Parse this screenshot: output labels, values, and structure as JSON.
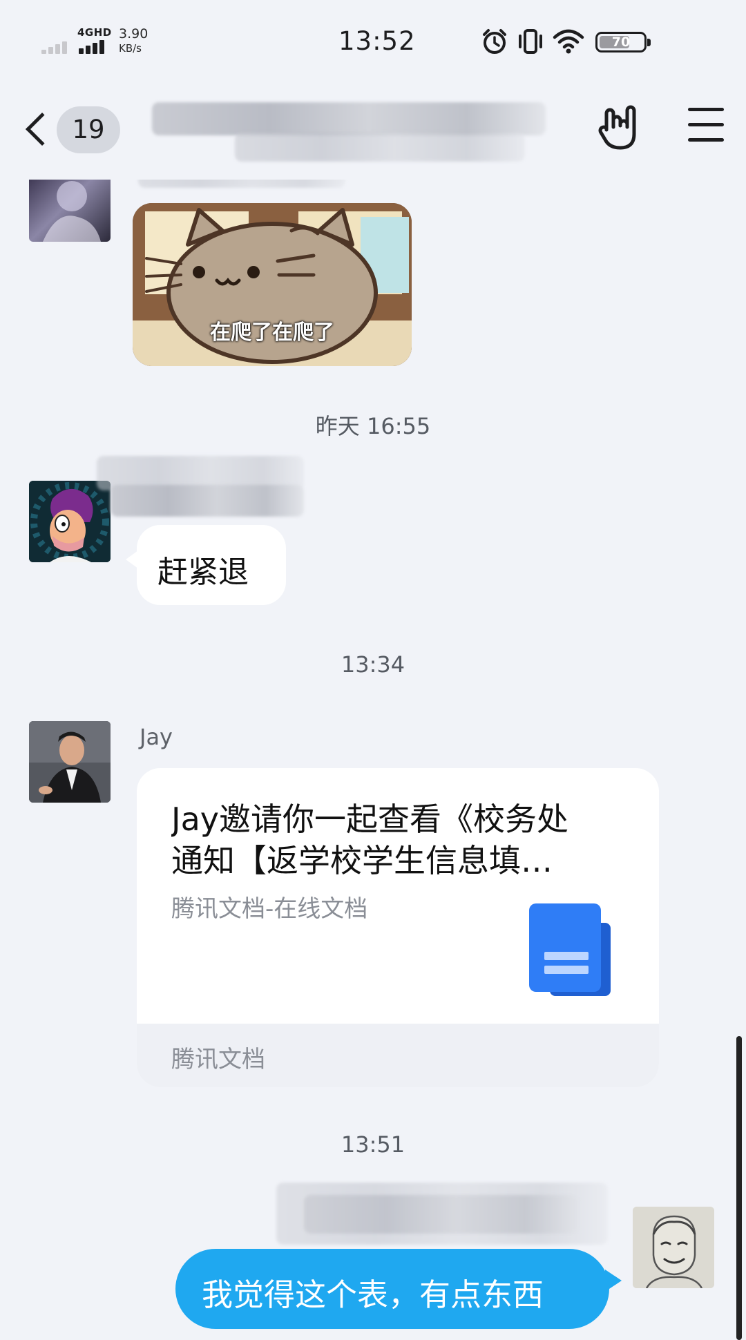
{
  "status_bar": {
    "network_type": "4GHD",
    "speed_value": "3.90",
    "speed_unit": "KB/s",
    "time": "13:52",
    "battery_level": "70",
    "battery_fraction": 0.7,
    "icons": [
      "signal-icon",
      "alarm-icon",
      "vibrate-icon",
      "wifi-icon",
      "battery-icon"
    ]
  },
  "header": {
    "back_icon": "chevron-left-icon",
    "unread_count": "19",
    "title_redacted": true,
    "gesture_icon": "rock-hand-icon",
    "menu_icon": "hamburger-menu-icon"
  },
  "messages": {
    "items": [
      {
        "type": "sticker",
        "direction": "incoming",
        "caption": "在爬了在爬了"
      },
      {
        "type": "timestamp",
        "text": "昨天 16:55"
      },
      {
        "type": "text",
        "direction": "incoming",
        "sender_redacted": true,
        "text": "赶紧退"
      },
      {
        "type": "timestamp",
        "text": "13:34"
      },
      {
        "type": "doc_card",
        "direction": "incoming",
        "sender": "Jay",
        "title_line1": "Jay邀请你一起查看《校务处",
        "title_line2": "通知【返学校学生信息填…",
        "subtitle": "腾讯文档-在线文档",
        "footer": "腾讯文档",
        "icon": "tencent-docs-icon"
      },
      {
        "type": "timestamp",
        "text": "13:51"
      },
      {
        "type": "text",
        "direction": "outgoing",
        "sender_redacted": true,
        "text": "我觉得这个表，有点东西"
      }
    ]
  },
  "colors": {
    "background": "#f1f3f8",
    "incoming_bubble": "#ffffff",
    "outgoing_bubble": "#1fa8f0",
    "doc_icon": "#2f7df6"
  }
}
